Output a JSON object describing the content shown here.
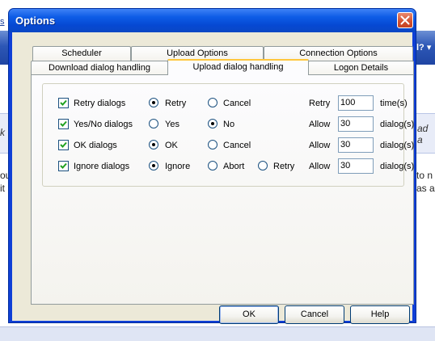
{
  "background": {
    "link_text": "s",
    "help_label": "l?",
    "band_left_text": "k",
    "band_right_text": "ad a",
    "left_lines": [
      "ou",
      "it"
    ],
    "right_lines": [
      "to n",
      "as a"
    ]
  },
  "dialog": {
    "title": "Options",
    "tabs_row_back": [
      "Scheduler",
      "Upload Options",
      "Connection Options"
    ],
    "tabs_row_front": [
      "Download dialog handling",
      "Upload dialog handling",
      "Logon Details"
    ],
    "active_tab": "Upload dialog handling",
    "rows": [
      {
        "label": "Retry dialogs",
        "checked": true,
        "options": [
          "Retry",
          "Cancel"
        ],
        "selected": "Retry",
        "count_label": "Retry",
        "count_value": "100",
        "unit": "time(s)"
      },
      {
        "label": "Yes/No dialogs",
        "checked": true,
        "options": [
          "Yes",
          "No"
        ],
        "selected": "No",
        "count_label": "Allow",
        "count_value": "30",
        "unit": "dialog(s)"
      },
      {
        "label": "OK dialogs",
        "checked": true,
        "options": [
          "OK",
          "Cancel"
        ],
        "selected": "OK",
        "count_label": "Allow",
        "count_value": "30",
        "unit": "dialog(s)"
      },
      {
        "label": "Ignore dialogs",
        "checked": true,
        "options": [
          "Ignore",
          "Abort",
          "Retry"
        ],
        "selected": "Ignore",
        "count_label": "Allow",
        "count_value": "30",
        "unit": "dialog(s)"
      }
    ],
    "buttons": {
      "ok": "OK",
      "cancel": "Cancel",
      "help": "Help"
    }
  },
  "colors": {
    "title_bar": "#0d5ce6",
    "dialog_face": "#ece9d8",
    "radio_selected": "#21a121",
    "close_button": "#d2502f"
  },
  "icons": {
    "close": "close-icon",
    "check": "checkmark-icon"
  }
}
